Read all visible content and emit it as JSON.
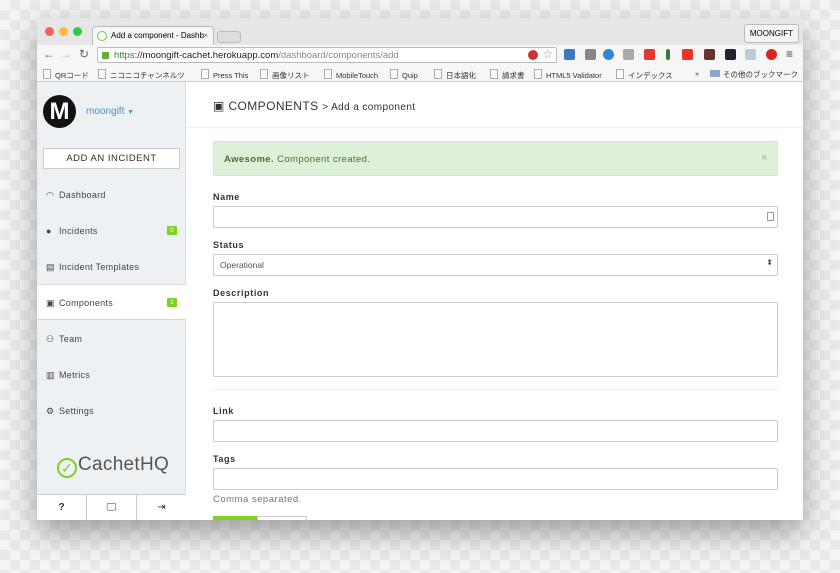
{
  "browser": {
    "tab_title": "Add a component - Dashb",
    "tab_close": "×",
    "profile": "MOONGIFT",
    "url": {
      "scheme": "https",
      "host": "://moongift-cachet.herokuapp.com",
      "path": "/dashboard/components/add"
    },
    "bookmarks": [
      "QRコード",
      "ニコニコチャンネルツ",
      "Press This",
      "画像リスト",
      "MobileTouch",
      "Quip",
      "日本語化",
      "請求書",
      "HTML5 Validator",
      "インデックス"
    ],
    "bookmarks_more": "»",
    "other_bookmarks": "その他のブックマーク"
  },
  "sidebar": {
    "username": "moongift",
    "avatar_letter": "M",
    "add_incident": "ADD AN INCIDENT",
    "items": [
      {
        "label": "Dashboard",
        "icon": "◠"
      },
      {
        "label": "Incidents",
        "icon": "●",
        "badge": "0"
      },
      {
        "label": "Incident Templates",
        "icon": "▤"
      },
      {
        "label": "Components",
        "icon": "▣",
        "badge": "1"
      },
      {
        "label": "Team",
        "icon": "⚇"
      },
      {
        "label": "Metrics",
        "icon": "▥"
      },
      {
        "label": "Settings",
        "icon": "⚙"
      }
    ],
    "logo": "CachetHQ",
    "footer": {
      "help": "?",
      "monitor": "🖵",
      "logout": "⇥"
    }
  },
  "main": {
    "section": "COMPONENTS",
    "crumb": "> Add a component",
    "alert": {
      "strong": "Awesome.",
      "text": " Component created.",
      "close": "×"
    },
    "form": {
      "name_label": "Name",
      "name_value": "",
      "status_label": "Status",
      "status_value": "Operational",
      "description_label": "Description",
      "link_label": "Link",
      "tags_label": "Tags",
      "tags_help": "Comma separated."
    }
  },
  "colors": {
    "accent": "#7ed321",
    "link": "#4a8fd0",
    "alert_bg": "#dff0d8"
  }
}
